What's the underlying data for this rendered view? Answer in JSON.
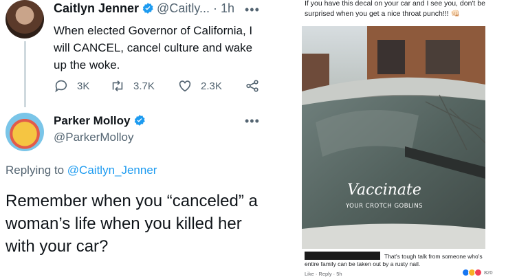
{
  "tweet1": {
    "name": "Caitlyn Jenner",
    "handle": "@Caitly...",
    "time": "· 1h",
    "more": "•••",
    "text": "When elected Governor of California, I will CANCEL, cancel culture and wake up the woke.",
    "replies": "3K",
    "retweets": "3.7K",
    "likes": "2.3K"
  },
  "tweet2": {
    "name": "Parker Molloy",
    "handle": "@ParkerMolloy",
    "more": "•••",
    "replying_prefix": "Replying to",
    "replying_to": "@Caitlyn_Jenner",
    "text": "Remember when you “canceled” a woman’s life when you killed her with your car?"
  },
  "facebook_post": {
    "caption": "If you have this decal on your car and I see you, don't be surprised when you get a nice throat punch!!! 👊🏻",
    "decal_title": "Vaccinate",
    "decal_subtitle": "YOUR CROTCH GOBLINS",
    "reply_line1": "That's tough talk from someone who's",
    "reply_line2": "entire family can be taken out by a rusty nail.",
    "reply_actions": "Like · Reply · 5h",
    "reaction_count": "820"
  },
  "colors": {
    "twitter_blue": "#1d9bf0",
    "text_primary": "#0f1419",
    "text_secondary": "#536471"
  }
}
